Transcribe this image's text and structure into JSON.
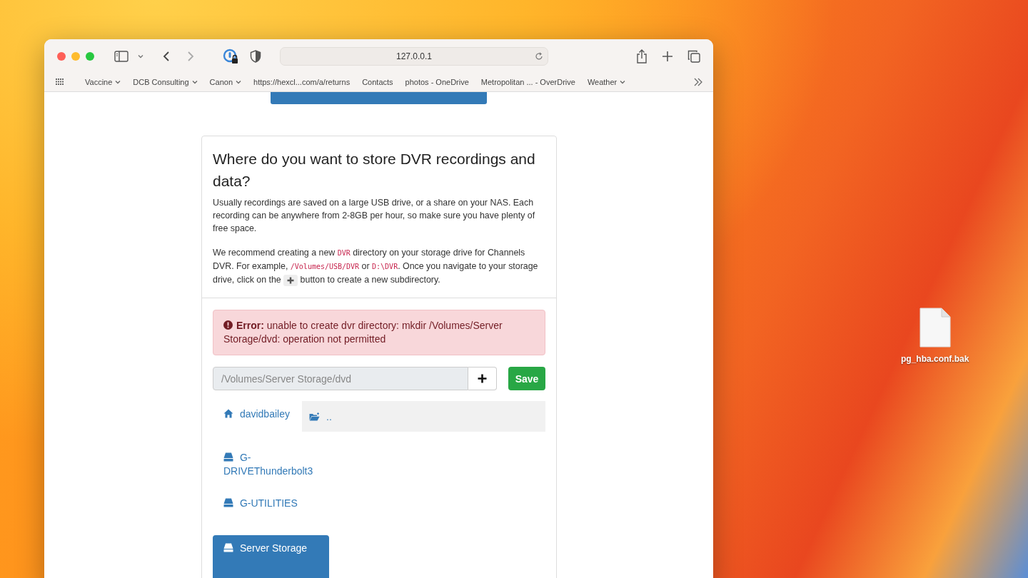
{
  "browser": {
    "url": "127.0.0.1",
    "bookmarks": [
      {
        "label": "Vaccine",
        "menu": true
      },
      {
        "label": "DCB Consulting",
        "menu": true
      },
      {
        "label": "Canon",
        "menu": true
      },
      {
        "label": "https://hexcl...com/a/returns",
        "menu": false
      },
      {
        "label": "Contacts",
        "menu": false
      },
      {
        "label": "photos - OneDrive",
        "menu": false
      },
      {
        "label": "Metropolitan ... - OverDrive",
        "menu": false
      },
      {
        "label": "Weather",
        "menu": true
      }
    ]
  },
  "card": {
    "title": "Where do you want to store DVR recordings and data?",
    "intro": "Usually recordings are saved on a large USB drive, or a share on your NAS. Each recording can be anywhere from 2-8GB per hour, so make sure you have plenty of free space.",
    "recommendation": [
      {
        "kind": "text",
        "text": "We recommend creating a new "
      },
      {
        "kind": "code",
        "text": "DVR"
      },
      {
        "kind": "text",
        "text": " directory on your storage drive for Channels DVR. For example, "
      },
      {
        "kind": "code",
        "text": "/Volumes/USB/DVR"
      },
      {
        "kind": "text",
        "text": " or "
      },
      {
        "kind": "code",
        "text": "D:\\DVR"
      },
      {
        "kind": "text",
        "text": ". Once you navigate to your storage drive, click on the "
      },
      {
        "kind": "plus"
      },
      {
        "kind": "text",
        "text": " button to create a new subdirectory."
      }
    ]
  },
  "error": {
    "label": "Error:",
    "message": "unable to create dvr directory: mkdir /Volumes/Server Storage/dvd: operation not permitted"
  },
  "path_field": {
    "value": "/Volumes/Server Storage/dvd"
  },
  "save_button": "Save",
  "locations": [
    {
      "name": "davidbailey",
      "kind": "home",
      "selected": false
    },
    {
      "name": "G-DRIVEThunderbolt3",
      "kind": "drive",
      "selected": false
    },
    {
      "name": "G-UTILITIES",
      "kind": "drive",
      "selected": false
    },
    {
      "name": "Server Storage",
      "kind": "drive",
      "selected": true
    }
  ],
  "folders": [
    {
      "name": "..",
      "kind": "parent"
    }
  ],
  "desktop": {
    "files": [
      {
        "name": "pg_hba.conf.bak"
      }
    ]
  }
}
